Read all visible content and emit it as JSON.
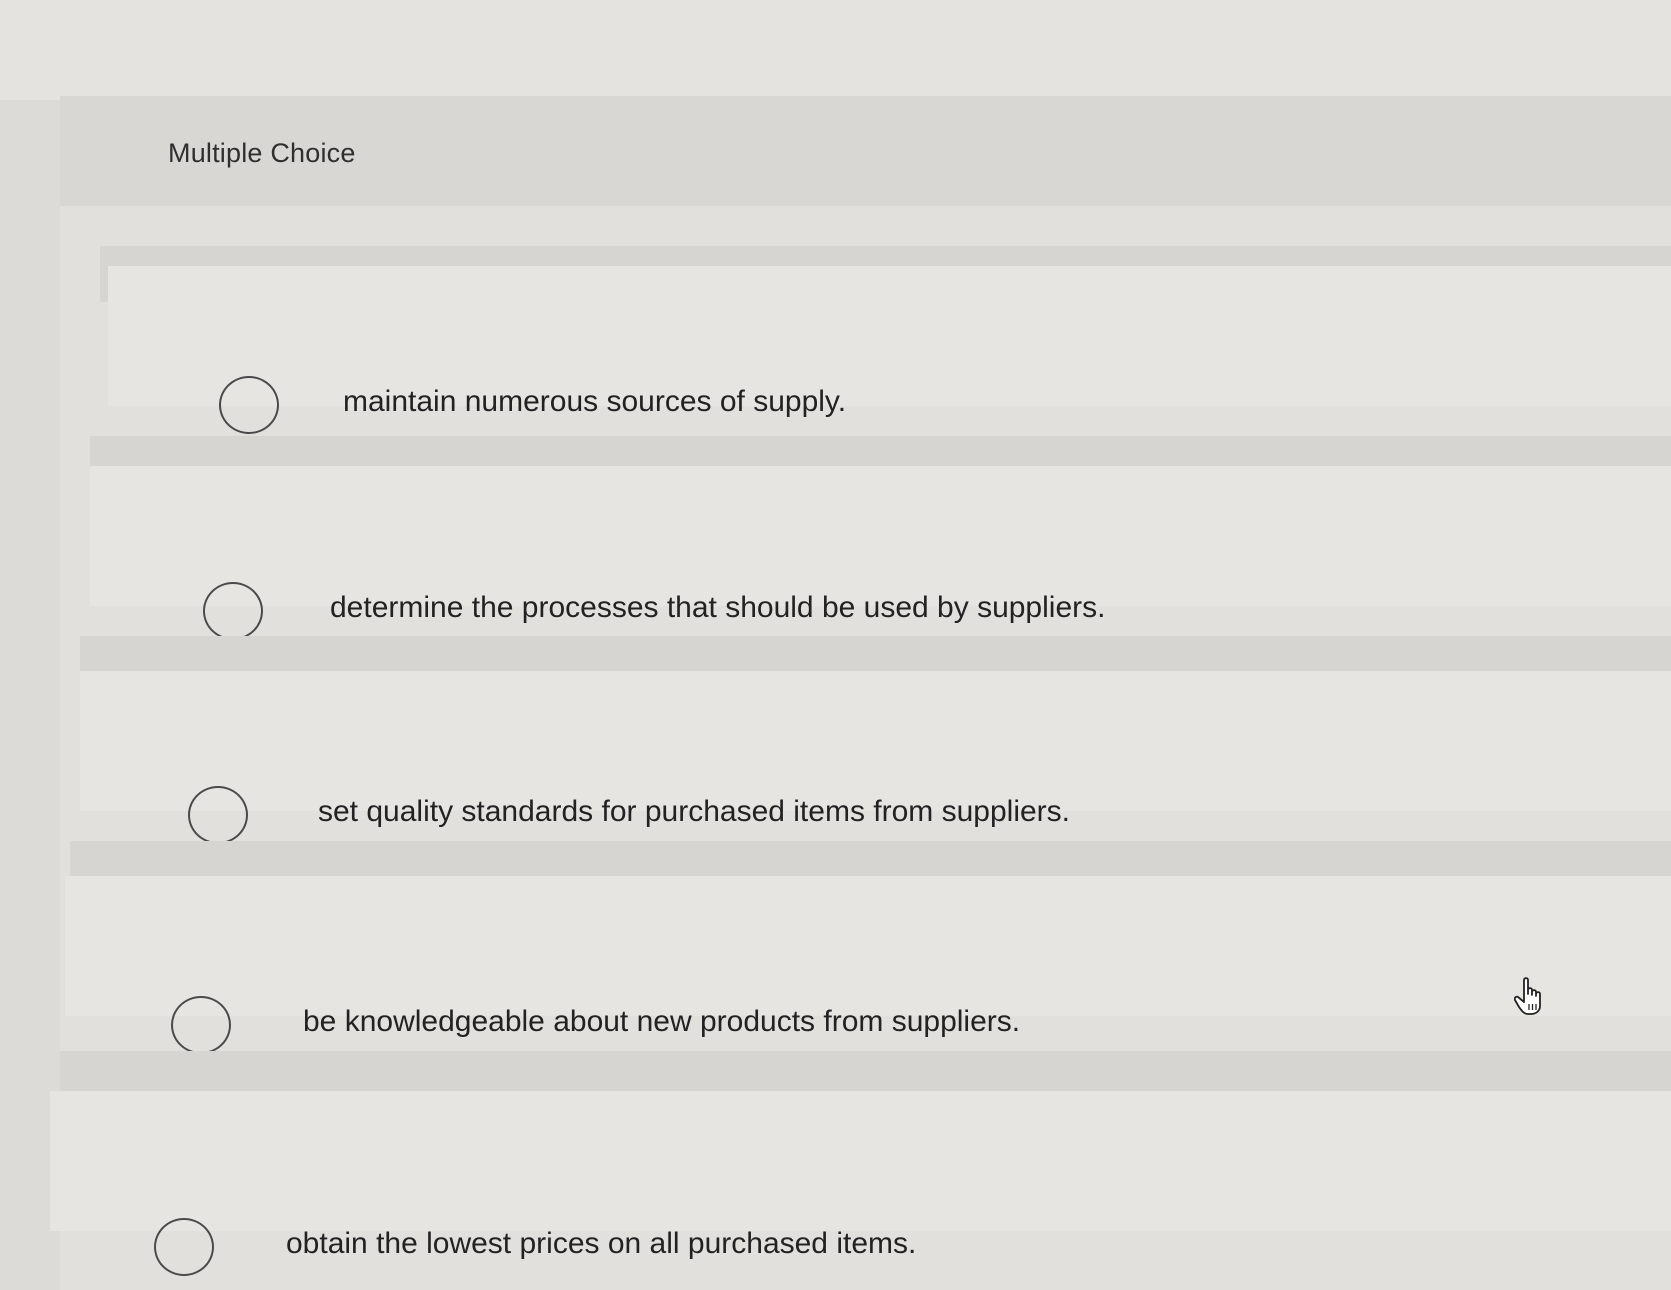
{
  "question": {
    "type_label": "Multiple Choice"
  },
  "choices": [
    {
      "label": "maintain numerous sources of supply."
    },
    {
      "label": "determine the processes that should be used by suppliers."
    },
    {
      "label": "set quality standards for purchased items from suppliers."
    },
    {
      "label": "be knowledgeable about new products from suppliers."
    },
    {
      "label": "obtain the lowest prices on all purchased items."
    }
  ],
  "icons": {
    "cursor": "pointer-hand-icon"
  },
  "colors": {
    "background": "#dcdbd8",
    "card": "#e1e0dd",
    "text": "#222222",
    "radio_border": "#4a4a4a"
  }
}
